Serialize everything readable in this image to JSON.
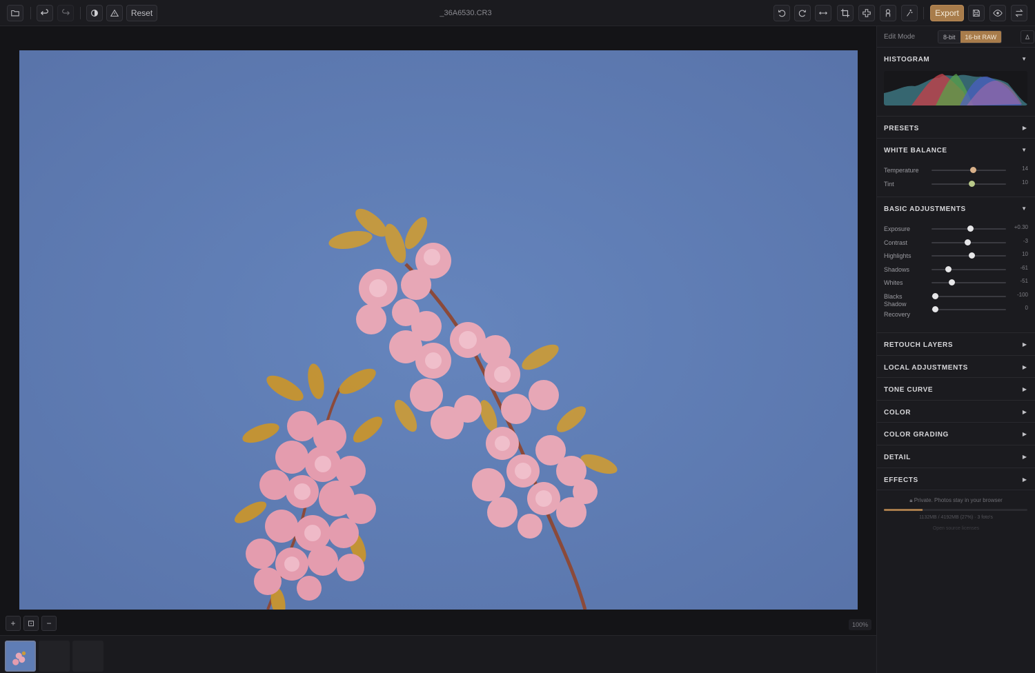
{
  "toolbar": {
    "reset_label": "Reset",
    "filename": "_36A6530.CR3",
    "export_label": "Export",
    "icons": [
      "folder-icon",
      "undo-icon",
      "redo-icon",
      "compare-icon",
      "warning-icon",
      "rotate-left-icon",
      "rotate-right-icon",
      "flip-icon",
      "crop-icon",
      "heal-icon",
      "mask-icon",
      "ai-icon",
      "save-icon",
      "eye-icon",
      "swap-icon"
    ]
  },
  "canvas": {
    "zoom_in_label": "+",
    "fit_label": "⊡",
    "zoom_out_label": "−",
    "zoom_level": "100%"
  },
  "panel": {
    "edit_mode": {
      "label": "Edit Mode",
      "options": [
        "8-bit",
        "16-bit RAW"
      ],
      "selected": "16-bit RAW",
      "delta_label": "Δ"
    },
    "histogram": {
      "title": "HISTOGRAM",
      "expanded": true
    },
    "presets": {
      "title": "PRESETS",
      "expanded": false
    },
    "white_balance": {
      "title": "WHITE BALANCE",
      "expanded": true,
      "sliders": [
        {
          "name": "Temperature",
          "value": "14",
          "position": 0.56,
          "knob_color": "#d8b089"
        },
        {
          "name": "Tint",
          "value": "10",
          "position": 0.54,
          "knob_color": "#b9c98a"
        }
      ]
    },
    "basic": {
      "title": "BASIC ADJUSTMENTS",
      "expanded": true,
      "sliders": [
        {
          "name": "Exposure",
          "value": "+0.30",
          "position": 0.52
        },
        {
          "name": "Contrast",
          "value": "-3",
          "position": 0.48
        },
        {
          "name": "Highlights",
          "value": "10",
          "position": 0.54
        },
        {
          "name": "Shadows",
          "value": "-61",
          "position": 0.22
        },
        {
          "name": "Whites",
          "value": "-51",
          "position": 0.27
        },
        {
          "name": "Blacks",
          "value": "-100",
          "position": 0.05
        },
        {
          "name": "Shadow Recovery",
          "value": "0",
          "position": 0.05
        }
      ]
    },
    "collapsed_sections": [
      "RETOUCH LAYERS",
      "LOCAL ADJUSTMENTS",
      "TONE CURVE",
      "COLOR",
      "COLOR GRADING",
      "DETAIL",
      "EFFECTS"
    ],
    "footer": {
      "private_text": "Private. Photos stay in your browser",
      "memory_text": "1132MB / 4192MB (27%) · 3 foto's",
      "memory_fraction": 0.27,
      "oss_text": "Open source licenses"
    }
  },
  "colors": {
    "accent": "#a87c4b",
    "sky": "#5f7db5"
  }
}
